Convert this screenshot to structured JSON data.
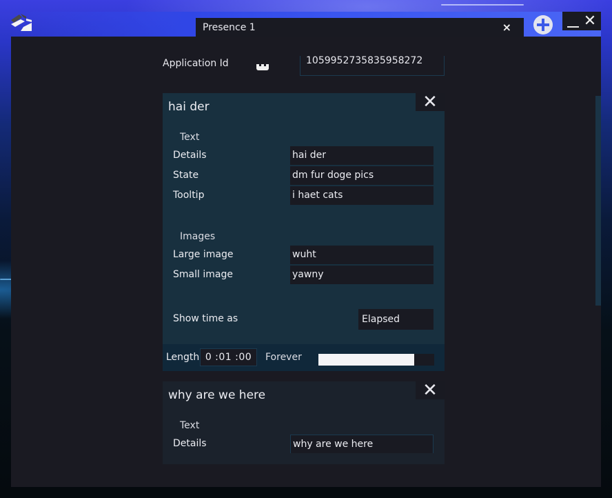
{
  "window": {
    "tab_label": "Presence 1",
    "tab_close_glyph": "×",
    "add_tab_label": "+",
    "minimize_glyph": "_",
    "close_glyph": "✕"
  },
  "app_id": {
    "label": "Application Id",
    "value": "1059952735835958272"
  },
  "presences": [
    {
      "title": "hai der",
      "remove_glyph": "✕",
      "text_section": "Text",
      "fields": [
        {
          "label": "Details",
          "value": "hai der"
        },
        {
          "label": "State",
          "value": "dm fur doge pics"
        },
        {
          "label": "Tooltip",
          "value": "i haet cats"
        }
      ],
      "images_section": "Images",
      "images": [
        {
          "label": "Large image",
          "value": "wuht"
        },
        {
          "label": "Small image",
          "value": "yawny"
        }
      ],
      "show_time_label": "Show time as",
      "show_time_value": "Elapsed",
      "length_label": "Length",
      "length_value": "0 :01 :00",
      "forever_label": "Forever",
      "length_progress_percent": 83
    },
    {
      "title": "why are we here",
      "remove_glyph": "✕",
      "text_section": "Text",
      "fields": [
        {
          "label": "Details",
          "value": "why are we here"
        }
      ]
    }
  ],
  "colors": {
    "accent_blue": "#3b5ae8",
    "card_active": "#18303f",
    "card_inactive": "#1b222c",
    "panel": "#1a1a22"
  }
}
